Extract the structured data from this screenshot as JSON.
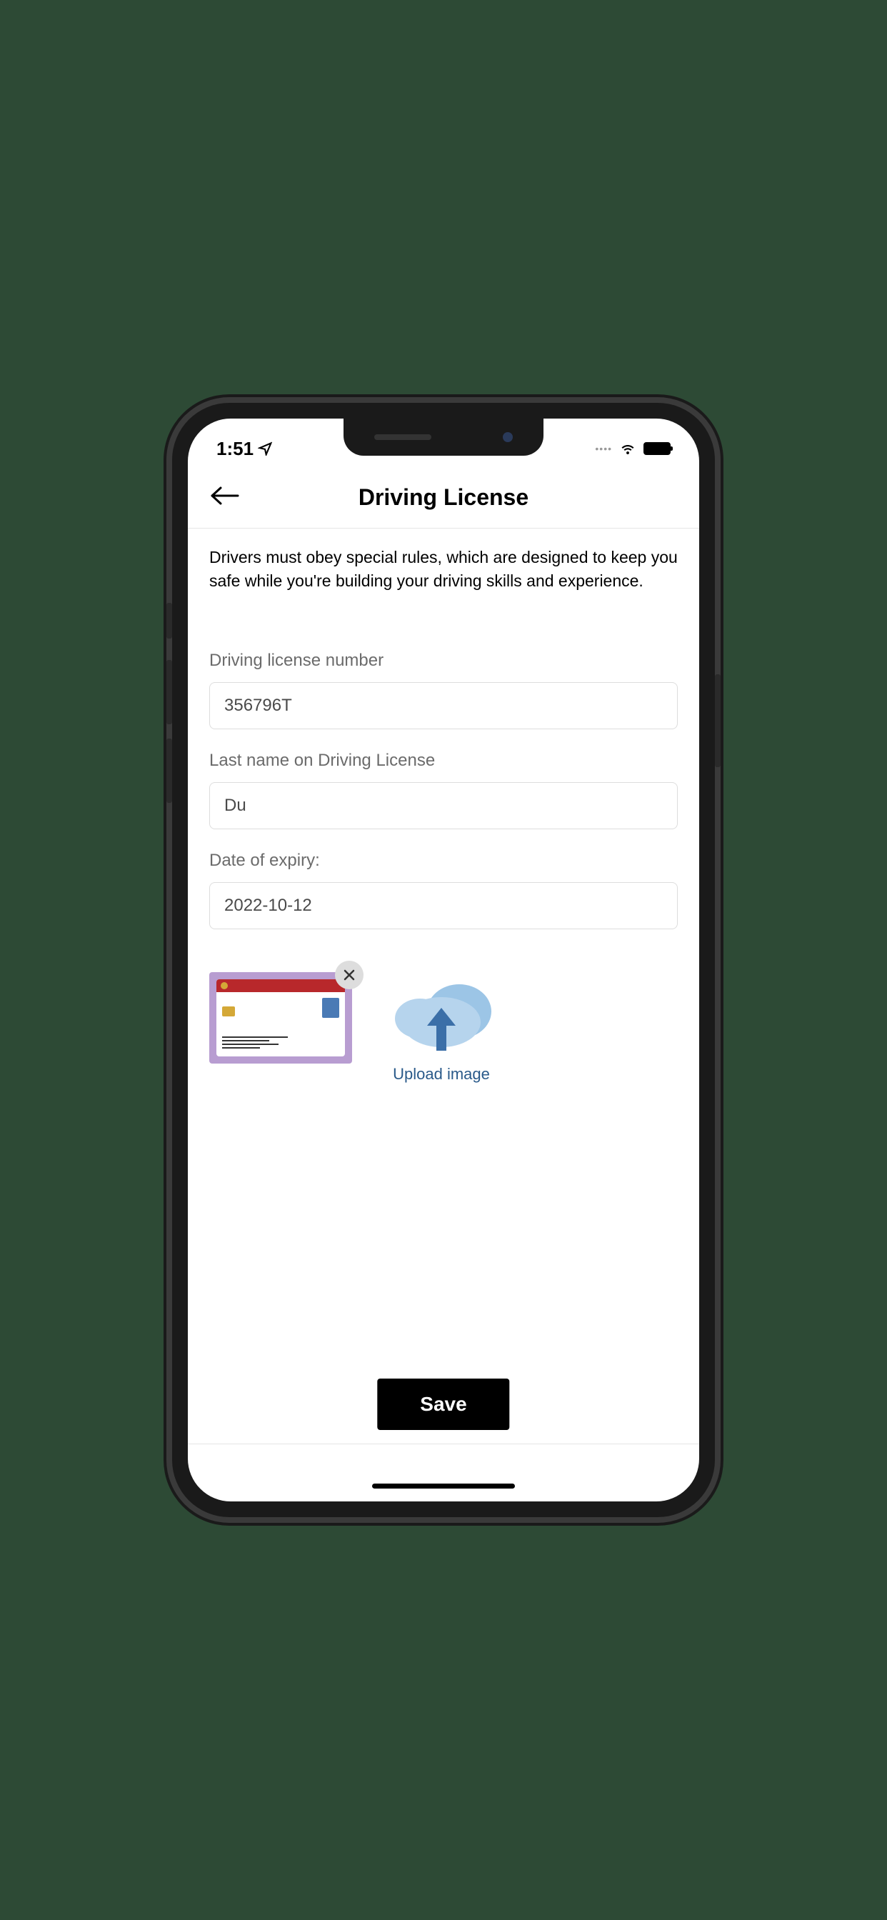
{
  "status": {
    "time": "1:51"
  },
  "header": {
    "title": "Driving License"
  },
  "content": {
    "description": "Drivers must obey special rules, which are designed to keep you safe while you're building your driving skills and experience."
  },
  "form": {
    "license_number": {
      "label": "Driving license number",
      "value": "356796T"
    },
    "last_name": {
      "label": "Last name on Driving License",
      "value": "Du"
    },
    "expiry": {
      "label": "Date of expiry:",
      "value": "2022-10-12"
    }
  },
  "upload": {
    "label": "Upload image"
  },
  "actions": {
    "save_label": "Save"
  }
}
